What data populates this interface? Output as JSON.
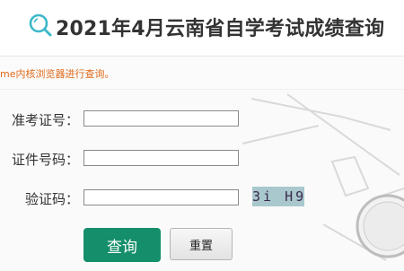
{
  "header": {
    "title": "2021年4月云南省自学考试成绩查询",
    "icon": "search-icon",
    "accent": "#3bb8c9"
  },
  "notice": {
    "text": "me内核浏览器进行查询。",
    "color": "#e06a1a"
  },
  "form": {
    "fields": [
      {
        "label": "准考证号：",
        "value": "",
        "placeholder": ""
      },
      {
        "label": "证件号码：",
        "value": "",
        "placeholder": ""
      },
      {
        "label": "验证码：",
        "value": "",
        "placeholder": ""
      }
    ],
    "captcha_text": "3i H9",
    "captcha_bg": "#a9c8cd"
  },
  "buttons": {
    "query_label": "查询",
    "query_color": "#158f6b",
    "reset_label": "重置"
  }
}
